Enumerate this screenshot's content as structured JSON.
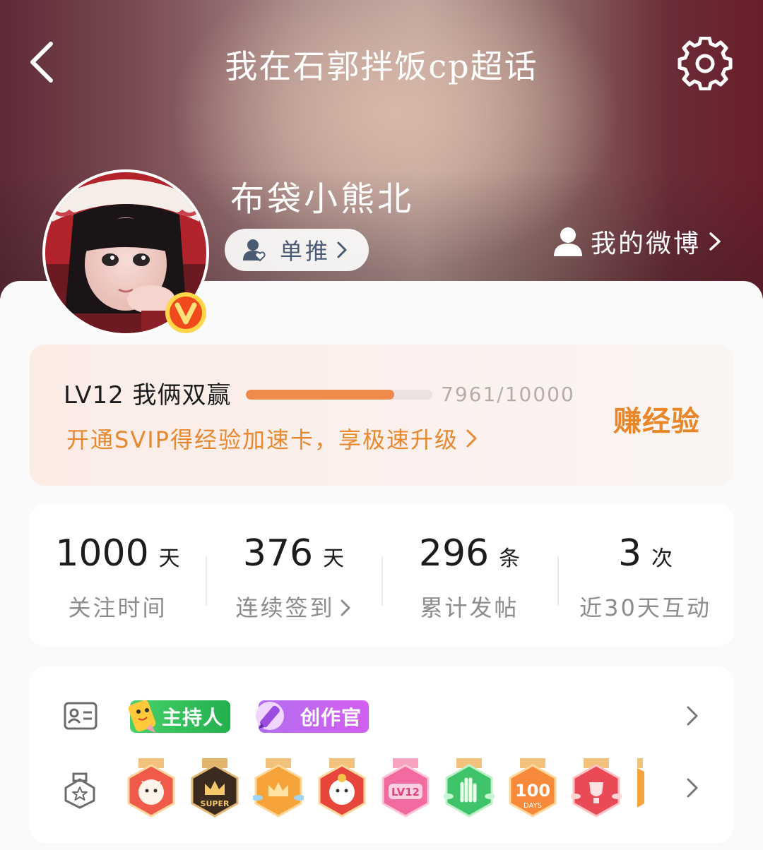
{
  "header": {
    "title": "我在石郭拌饭cp超话"
  },
  "profile": {
    "name": "布袋小熊北",
    "fan_tag": "单推",
    "my_weibo": "我的微博"
  },
  "level": {
    "label": "LV12 我俩双赢",
    "progress_text": "7961/10000",
    "progress_fraction": 0.7961,
    "svip_promo": "开通SVIP得经验加速卡，享极速升级",
    "earn_button": "赚经验",
    "accent_color": "#f08a4b"
  },
  "stats": [
    {
      "value": "1000",
      "unit": "天",
      "label": "关注时间"
    },
    {
      "value": "376",
      "unit": "天",
      "label": "连续签到"
    },
    {
      "value": "296",
      "unit": "条",
      "label": "累计发帖"
    },
    {
      "value": "3",
      "unit": "次",
      "label": "近30天互动"
    }
  ],
  "roles": {
    "host": "主持人",
    "creator": "创作官"
  },
  "medals": {
    "items": [
      "cat-medal",
      "super-crown-medal",
      "wing-crown-medal",
      "red-cat-medal",
      "lv12-medal",
      "hand-medal",
      "100-days-medal",
      "trophy-medal"
    ],
    "super_text": "SUPER",
    "lv_text": "LV12",
    "days_text": "DAYS",
    "hundred_text": "100"
  }
}
